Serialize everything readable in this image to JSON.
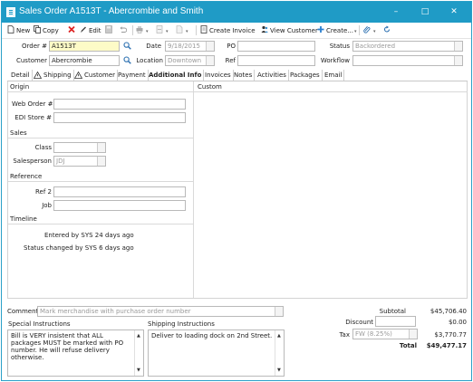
{
  "window": {
    "title": "Sales Order A1513T - Abercrombie and Smith",
    "minimize": "–",
    "maximize": "□",
    "close": "✕"
  },
  "toolbar": {
    "new": "New",
    "copy": "Copy",
    "edit": "Edit",
    "create_invoice": "Create Invoice",
    "view_customer": "View Customer",
    "create": "Create..."
  },
  "header": {
    "order_label": "Order #",
    "order_value": "A1513T",
    "date_label": "Date",
    "date_value": "9/18/2015",
    "po_label": "PO",
    "po_value": "",
    "status_label": "Status",
    "status_value": "Backordered",
    "customer_label": "Customer",
    "customer_value": "Abercrombie",
    "location_label": "Location",
    "location_value": "Downtown",
    "ref_label": "Ref",
    "ref_value": "",
    "workflow_label": "Workflow",
    "workflow_value": ""
  },
  "tabs": [
    "Detail",
    "Shipping",
    "Customer",
    "Payment",
    "Additional Info",
    "Invoices",
    "Notes",
    "Activities",
    "Packages",
    "Email"
  ],
  "origin": {
    "section": "Origin",
    "web_order_label": "Web Order #",
    "web_order_value": "",
    "edi_store_label": "EDI Store #",
    "edi_store_value": ""
  },
  "custom": {
    "section": "Custom"
  },
  "sales": {
    "section": "Sales",
    "class_label": "Class",
    "class_value": "",
    "salesperson_label": "Salesperson",
    "salesperson_value": "JDJ"
  },
  "reference": {
    "section": "Reference",
    "ref2_label": "Ref 2",
    "ref2_value": "",
    "job_label": "Job",
    "job_value": ""
  },
  "timeline": {
    "section": "Timeline",
    "entered": "Entered by SYS  24 days ago",
    "status_changed": "Status changed by SYS  6 days ago"
  },
  "bottom": {
    "comment_label": "Comment",
    "comment_placeholder": "Mark merchandise with purchase order number",
    "special_label": "Special Instructions",
    "special_text": "Bill is VERY insistent that ALL packages MUST be marked with PO number.  He will refuse delivery otherwise.",
    "shipping_label": "Shipping Instructions",
    "shipping_text": "Deliver to loading dock on 2nd Street."
  },
  "totals": {
    "subtotal_label": "Subtotal",
    "subtotal_value": "$45,706.40",
    "discount_label": "Discount",
    "discount_value": "$0.00",
    "tax_label": "Tax",
    "tax_rate": "FW (8.25%)",
    "tax_value": "$3,770.77",
    "total_label": "Total",
    "total_value": "$49,477.17"
  }
}
